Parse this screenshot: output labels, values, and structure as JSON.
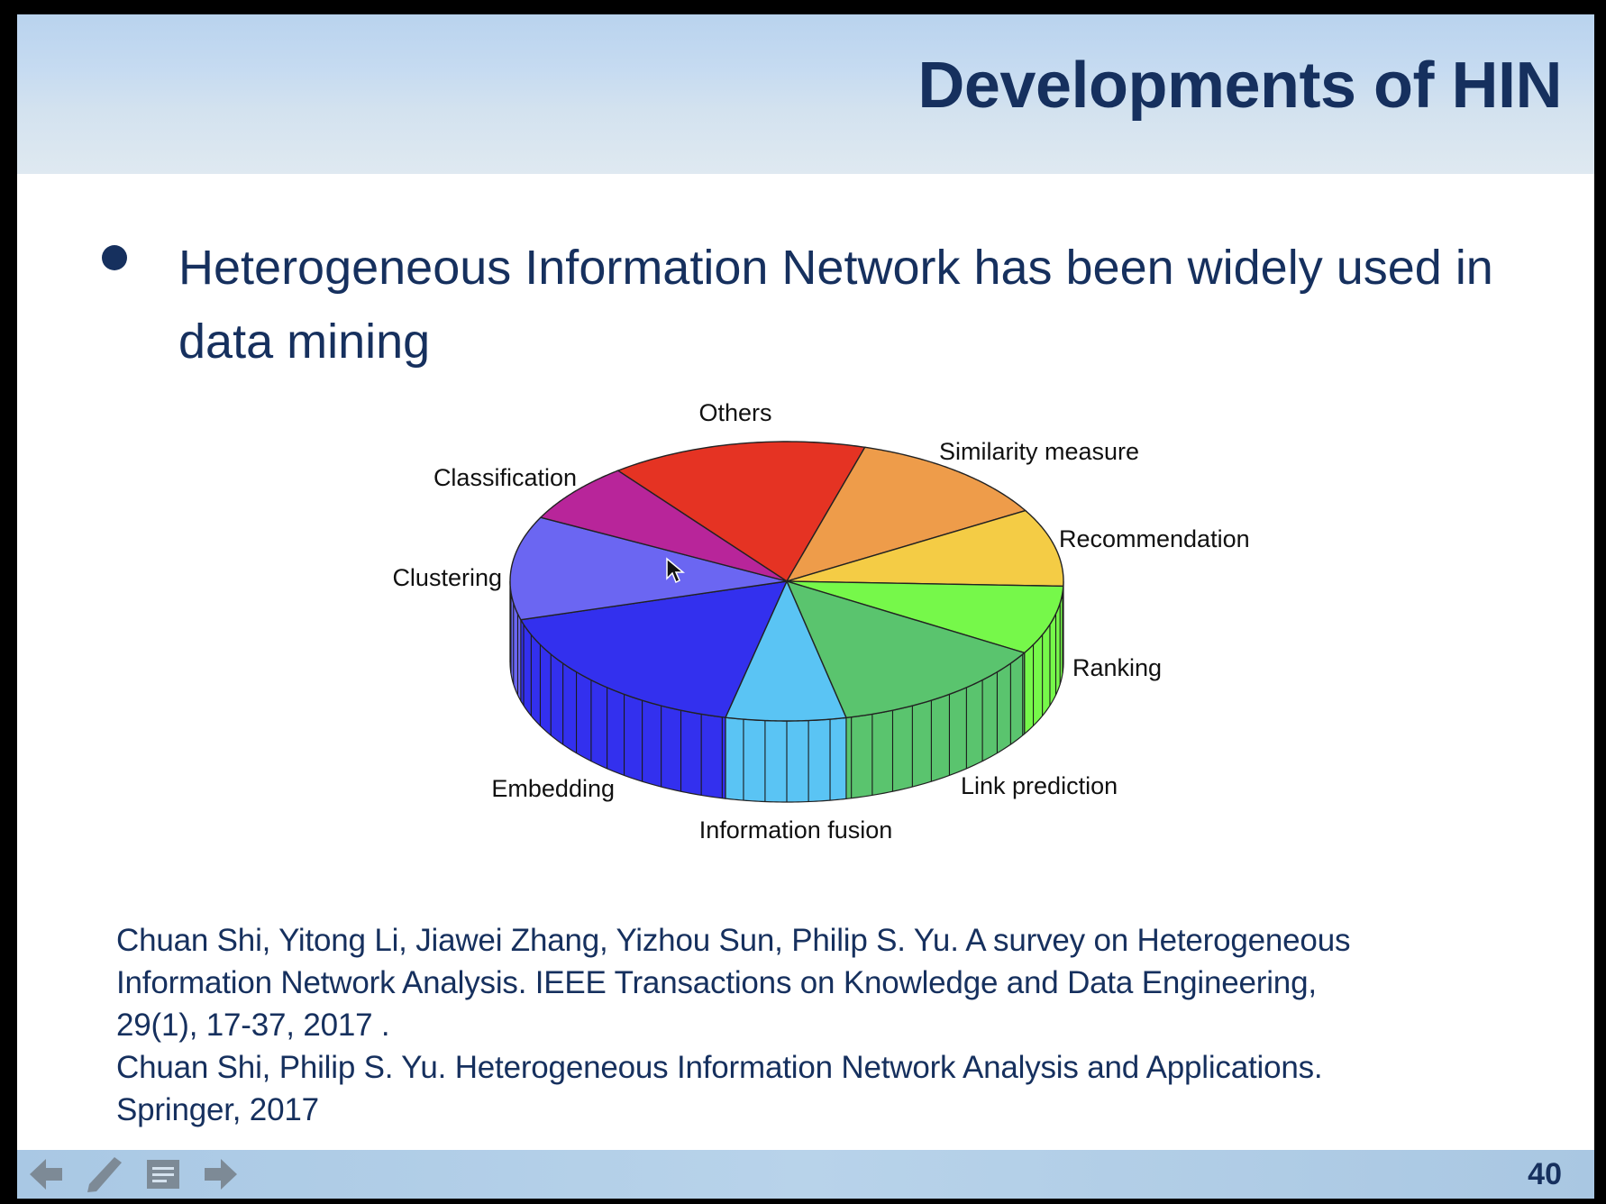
{
  "slide": {
    "title": "Developments of HIN",
    "bullet": "Heterogeneous Information Network has been widely used in data mining",
    "references": [
      "Chuan Shi, Yitong Li, Jiawei Zhang, Yizhou Sun, Philip S. Yu. A survey on Heterogeneous",
      "Information Network Analysis. IEEE Transactions on Knowledge and Data Engineering,",
      "29(1), 17-37, 2017 .",
      "Chuan Shi, Philip S. Yu. Heterogeneous Information Network Analysis and Applications.",
      "Springer, 2017"
    ],
    "page_number": "40"
  },
  "footer_icons": [
    "arrow-left-icon",
    "pencil-icon",
    "notes-icon",
    "arrow-right-icon"
  ],
  "chart_data": {
    "type": "pie",
    "style": "3d",
    "categories": [
      "Others",
      "Similarity measure",
      "Recommendation",
      "Ranking",
      "Link prediction",
      "Information fusion",
      "Embedding",
      "Clustering",
      "Classification"
    ],
    "values": [
      15,
      12,
      9,
      8,
      13,
      7,
      17,
      12,
      7
    ],
    "colors": [
      "#e53323",
      "#ee9c4a",
      "#f4cc45",
      "#76f84a",
      "#5ac46e",
      "#5ac4f4",
      "#3330ee",
      "#6b66f2",
      "#b8259a"
    ],
    "legend": "none"
  }
}
